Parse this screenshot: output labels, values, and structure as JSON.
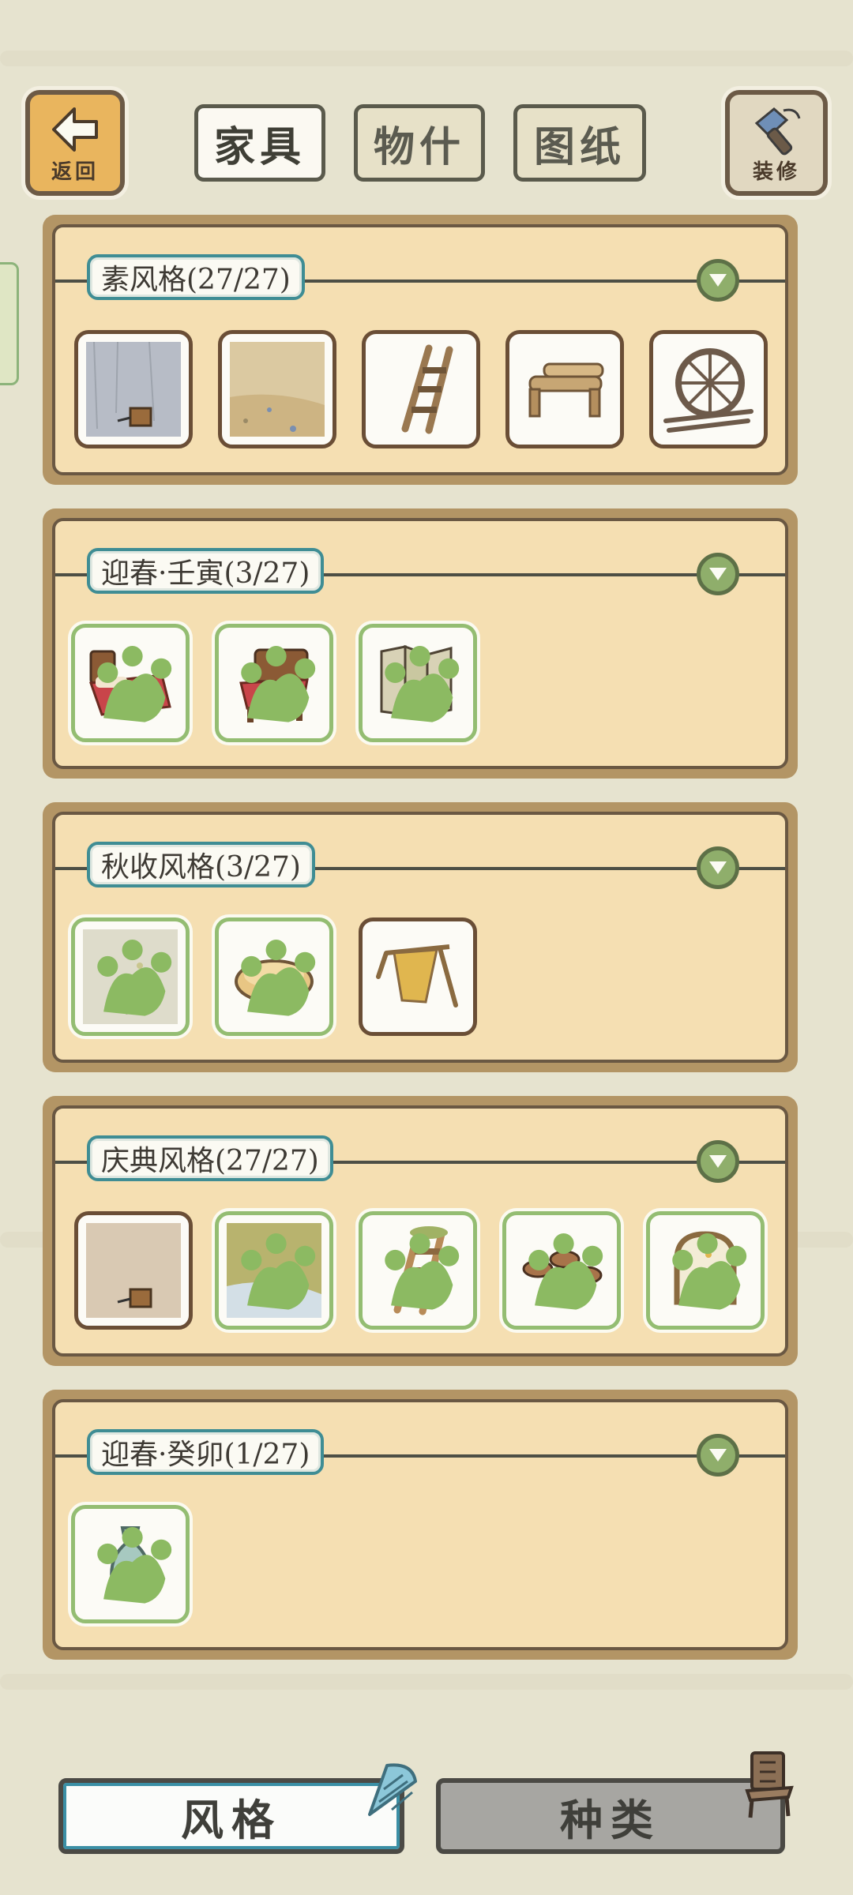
{
  "header": {
    "back_label": "返回",
    "tabs": [
      {
        "label": "家具",
        "active": true
      },
      {
        "label": "物什",
        "active": false
      },
      {
        "label": "图纸",
        "active": false
      }
    ],
    "decorate_label": "装修"
  },
  "sections": [
    {
      "title": "素风格(27/27)",
      "items": [
        "wall-item",
        "floor-item",
        "ladder-item",
        "log-bench-item",
        "round-window-item"
      ]
    },
    {
      "title": "迎春·壬寅(3/27)",
      "items": [
        "red-bed-item",
        "red-chair-item",
        "folding-screen-item"
      ]
    },
    {
      "title": "秋收风格(3/27)",
      "items": [
        "wall-item",
        "bread-basket-item",
        "straw-rack-item"
      ]
    },
    {
      "title": "庆典风格(27/27)",
      "items": [
        "wall-item",
        "floor-item",
        "mossy-ladder-item",
        "stools-item",
        "arched-window-item"
      ]
    },
    {
      "title": "迎春·癸卯(1/27)",
      "items": [
        "vase-item"
      ]
    }
  ],
  "bottom_tabs": [
    {
      "label": "风格",
      "active": true
    },
    {
      "label": "种类",
      "active": false
    }
  ],
  "colors": {
    "background": "#e6e3cf",
    "section_fill": "#f5dfb2",
    "section_frame": "#b39565",
    "title_border": "#3f8d94",
    "new_item_border": "#94bd72",
    "owned_item_border": "#6a4e36",
    "collapse_button": "#8fae6b"
  }
}
